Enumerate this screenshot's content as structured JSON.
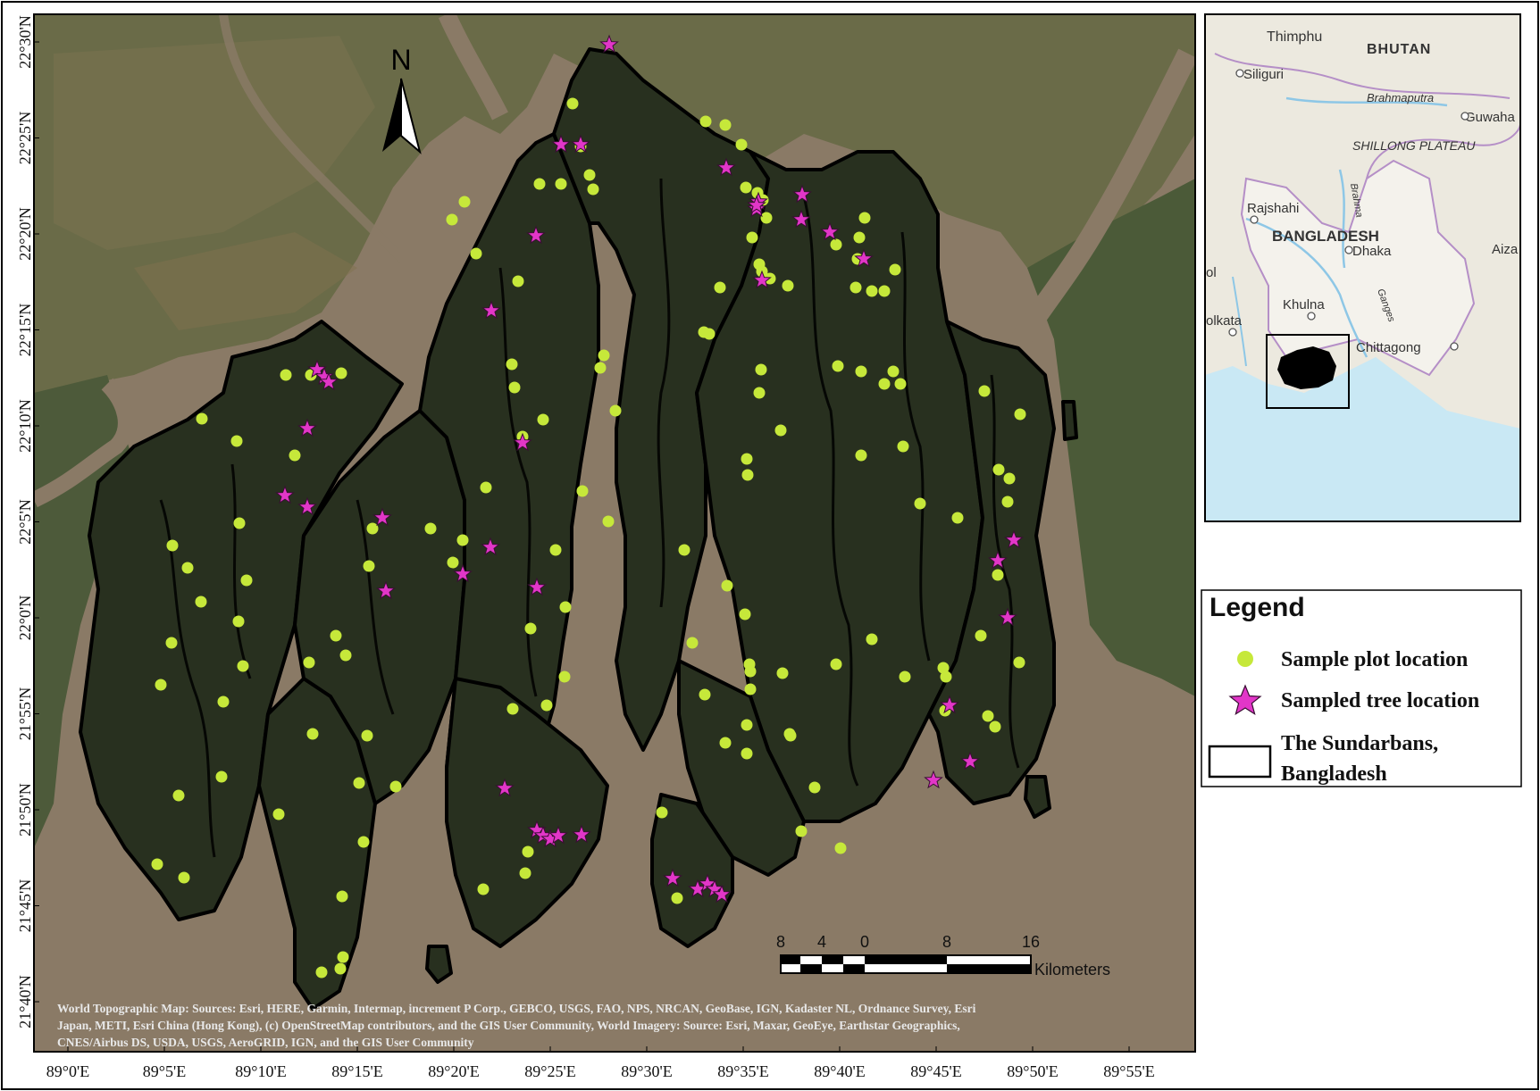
{
  "map": {
    "north_label": "N",
    "lat_labels": [
      "22°30'N",
      "22°25'N",
      "22°20'N",
      "22°15'N",
      "22°10'N",
      "22°5'N",
      "22°0'N",
      "21°55'N",
      "21°50'N",
      "21°45'N",
      "21°40'N"
    ],
    "lon_labels": [
      "89°0'E",
      "89°5'E",
      "89°10'E",
      "89°15'E",
      "89°20'E",
      "89°25'E",
      "89°30'E",
      "89°35'E",
      "89°40'E",
      "89°45'E",
      "89°50'E",
      "89°55'E"
    ],
    "scale": {
      "ticks": [
        "8",
        "4",
        "0",
        "8",
        "16"
      ],
      "unit": "Kilometers"
    },
    "credits": [
      "World Topographic Map: Sources: Esri, HERE, Garmin, Intermap, increment P Corp., GEBCO, USGS, FAO, NPS, NRCAN, GeoBase, IGN, Kadaster NL, Ordnance Survey, Esri",
      "Japan, METI, Esri China (Hong Kong), (c) OpenStreetMap contributors, and the GIS User Community, World Imagery: Source: Esri, Maxar, GeoEye, Earthstar Geographics,",
      "CNES/Airbus DS, USDA, USGS, AeroGRID, IGN, and the GIS User Community"
    ],
    "colors": {
      "water": "#8a7a66",
      "land": "#4a5535",
      "forest": "#28301f",
      "boundary": "#000000",
      "plot": "#c6e83a",
      "tree": "#e236c8"
    }
  },
  "inset": {
    "labels": {
      "thimphu": "Thimphu",
      "bhutan": "BHUTAN",
      "siliguri": "Siliguri",
      "brahmaputra": "Brahmaputra",
      "guwahati": "Guwaha",
      "shillong": "SHILLONG PLATEAU",
      "rajshahi": "Rajshahi",
      "bangladesh": "BANGLADESH",
      "dhaka": "Dhaka",
      "aizawl": "Aiza",
      "khulna": "Khulna",
      "kolkata": "olkata",
      "chittagong": "Chittagong",
      "gol": "ol",
      "ganges": "Ganges",
      "brahma_river": "Brahma"
    }
  },
  "legend": {
    "title": "Legend",
    "items": {
      "plot": "Sample plot location",
      "tree": "Sampled tree location",
      "boundary_line1": "The Sundarbans,",
      "boundary_line2": "Bangladesh"
    }
  }
}
